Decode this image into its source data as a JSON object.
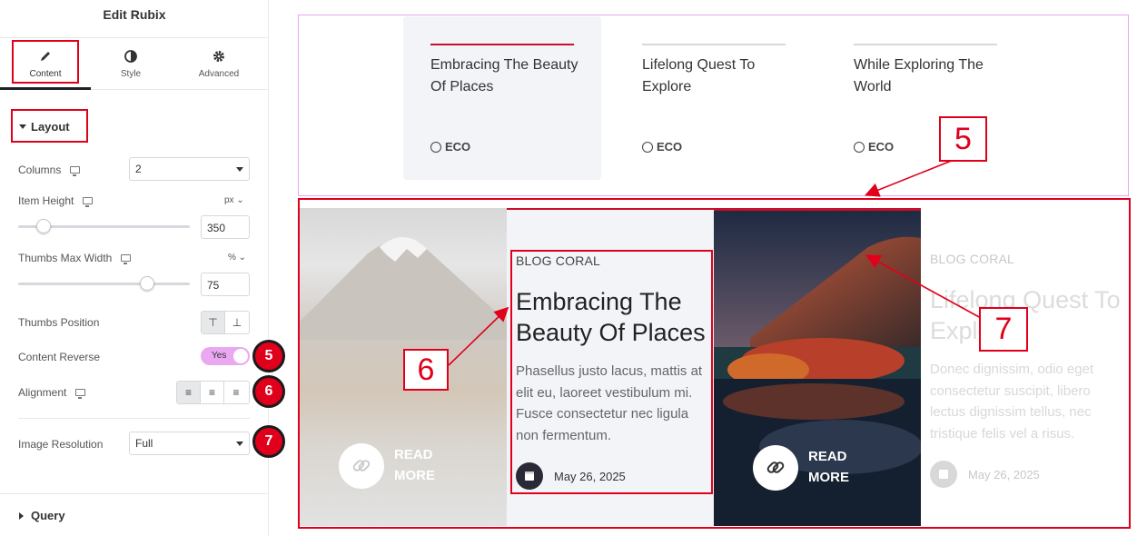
{
  "sidebar": {
    "title": "Edit Rubix",
    "tabs": [
      {
        "label": "Content",
        "icon": "pencil-icon"
      },
      {
        "label": "Style",
        "icon": "half-circle-icon"
      },
      {
        "label": "Advanced",
        "icon": "gear-icon"
      }
    ],
    "layout_section": "Layout",
    "query_section": "Query",
    "controls": {
      "columns_label": "Columns",
      "columns_value": "2",
      "item_height_label": "Item Height",
      "item_height_unit": "px",
      "item_height_value": "350",
      "item_height_level": 0.15,
      "thumbs_width_label": "Thumbs Max Width",
      "thumbs_width_unit": "%",
      "thumbs_width_value": "75",
      "thumbs_width_level": 0.75,
      "thumbs_position_label": "Thumbs Position",
      "content_reverse_label": "Content Reverse",
      "content_reverse_value": "Yes",
      "alignment_label": "Alignment",
      "image_resolution_label": "Image Resolution",
      "image_resolution_value": "Full"
    },
    "badges": [
      "5",
      "6",
      "7"
    ]
  },
  "preview": {
    "thumbs": [
      {
        "title": "Embracing The Beauty Of Places",
        "category": "ECO",
        "active": true
      },
      {
        "title": "Lifelong Quest To Explore",
        "category": "ECO",
        "active": false
      },
      {
        "title": "While Exploring The World",
        "category": "ECO",
        "active": false
      }
    ],
    "read_more": "READ MORE",
    "active_post": {
      "category": "BLOG CORAL",
      "title": "Embracing The Beauty Of Places",
      "description": "Phasellus justo lacus, mattis at elit eu, laoreet vestibulum mi. Fusce consectetur nec ligula non fermentum.",
      "date": "May 26, 2025"
    },
    "second_post": {
      "category": "BLOG CORAL",
      "title": "Lifelong Quest To Explore",
      "description": "Donec dignissim, odio eget consectetur suscipit, libero lectus dignissim tellus, nec tristique felis vel a risus.",
      "date": "May 26, 2025"
    },
    "callouts": [
      "5",
      "6",
      "7"
    ]
  },
  "colors": {
    "accent": "#c8102e",
    "annotation": "#e0001b",
    "toggle": "#e9a8f0"
  }
}
